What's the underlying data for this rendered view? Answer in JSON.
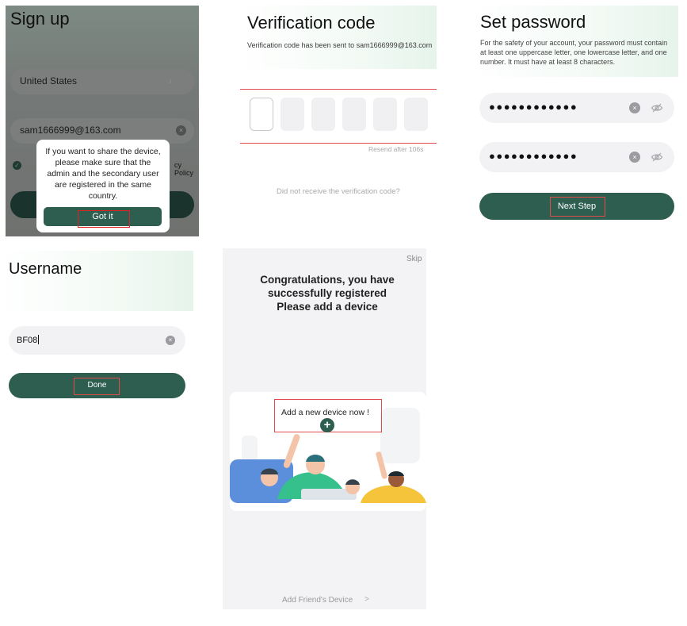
{
  "signup": {
    "title": "Sign up",
    "country": "United States",
    "country_chevron": "›",
    "email": "sam1666999@163.com",
    "clear_glyph": "×",
    "check_glyph": "✓",
    "policy_fragment": "cy Policy",
    "dialog_message": "If you want to share the device, please make sure that the admin and the secondary user are registered in the same country.",
    "dialog_button": "Got it"
  },
  "verification": {
    "title": "Verification code",
    "subtitle": "Verification code has been sent to sam1666999@163.com",
    "resend": "Resend after 106s",
    "not_received": "Did not receive the verification code?"
  },
  "password": {
    "title": "Set password",
    "description": "For the safety of your account, your password must contain at least one uppercase letter, one lowercase letter, and one number. It must have at least 8 characters.",
    "field1_dots": "●●●●●●●●●●●●",
    "field2_dots": "●●●●●●●●●●●●",
    "clear_glyph": "×",
    "next_button": "Next Step"
  },
  "username": {
    "title": "Username",
    "value": "BF08",
    "clear_glyph": "×",
    "done_button": "Done"
  },
  "congrats": {
    "skip": "Skip",
    "line1": "Congratulations, you have",
    "line2": "successfully registered",
    "line3": "Please add a device",
    "add_new_device": "Add a new device now !",
    "plus_glyph": "+",
    "add_friend_device": "Add Friend's Device",
    "friend_chevron": ">"
  },
  "colors": {
    "brand_green": "#2e5e50",
    "highlight_red": "#e04c4c",
    "field_bg": "#f2f2f4"
  },
  "icons": [
    "chevron-right-icon",
    "clear-icon",
    "check-icon",
    "eye-off-icon",
    "plus-icon"
  ]
}
